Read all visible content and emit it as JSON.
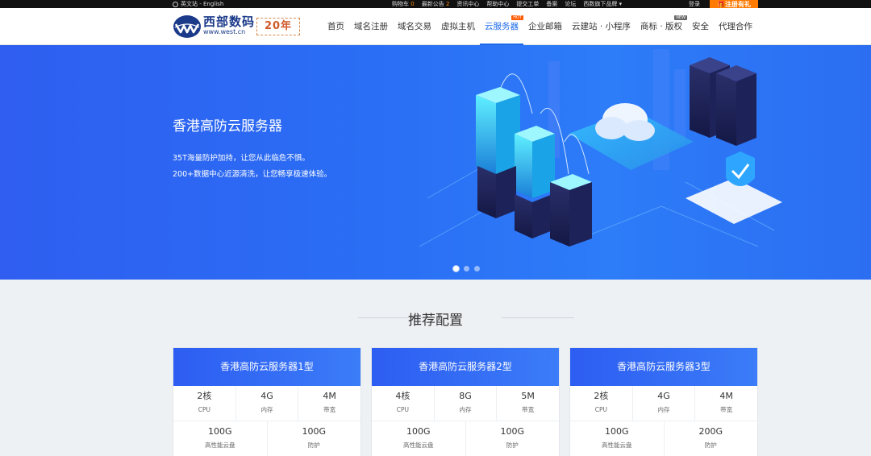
{
  "topbar": {
    "lang": "英文站 - English",
    "links": [
      {
        "label": "购物车",
        "count": "0"
      },
      {
        "label": "最新公告",
        "count": "2"
      },
      {
        "label": "资讯中心"
      },
      {
        "label": "帮助中心"
      },
      {
        "label": "提交工单"
      },
      {
        "label": "备案"
      },
      {
        "label": "论坛"
      },
      {
        "label": "西数旗下品牌"
      }
    ],
    "login": "登录",
    "register": "注册有礼"
  },
  "header": {
    "logo_cn": "西部数码",
    "logo_en": "www.west.cn",
    "anniversary": "20年",
    "nav": [
      {
        "label": "首页"
      },
      {
        "label": "域名注册"
      },
      {
        "label": "域名交易"
      },
      {
        "label": "虚拟主机"
      },
      {
        "label": "云服务器",
        "tag": "HOT",
        "active": true
      },
      {
        "label": "企业邮箱"
      },
      {
        "label": "云建站 · 小程序"
      },
      {
        "label": "商标 · 版权",
        "tag": "NEW"
      },
      {
        "label": "安全"
      },
      {
        "label": "代理合作"
      }
    ]
  },
  "banner": {
    "title": "香港高防云服务器",
    "line1": "35T海量防护加持，让您从此临危不惧。",
    "line2": "200+数据中心近源清洗，让您畅享极速体验。",
    "slides": 3,
    "active_slide": 1
  },
  "section": {
    "title": "推荐配置"
  },
  "plans": [
    {
      "name": "香港高防云服务器1型",
      "specs": [
        {
          "value": "2核",
          "label": "CPU"
        },
        {
          "value": "4G",
          "label": "内存"
        },
        {
          "value": "4M",
          "label": "带宽"
        }
      ],
      "storage": [
        {
          "value": "100G",
          "label": "高性能云盘"
        },
        {
          "value": "100G",
          "label": "防护"
        }
      ]
    },
    {
      "name": "香港高防云服务器2型",
      "specs": [
        {
          "value": "4核",
          "label": "CPU"
        },
        {
          "value": "8G",
          "label": "内存"
        },
        {
          "value": "5M",
          "label": "带宽"
        }
      ],
      "storage": [
        {
          "value": "100G",
          "label": "高性能云盘"
        },
        {
          "value": "100G",
          "label": "防护"
        }
      ]
    },
    {
      "name": "香港高防云服务器3型",
      "specs": [
        {
          "value": "2核",
          "label": "CPU"
        },
        {
          "value": "4G",
          "label": "内存"
        },
        {
          "value": "4M",
          "label": "带宽"
        }
      ],
      "storage": [
        {
          "value": "100G",
          "label": "高性能云盘"
        },
        {
          "value": "200G",
          "label": "防护"
        }
      ]
    }
  ],
  "colors": {
    "accent": "#1e6be8",
    "register": "#ff7a00",
    "banner_blue": "#2d6ff5"
  }
}
